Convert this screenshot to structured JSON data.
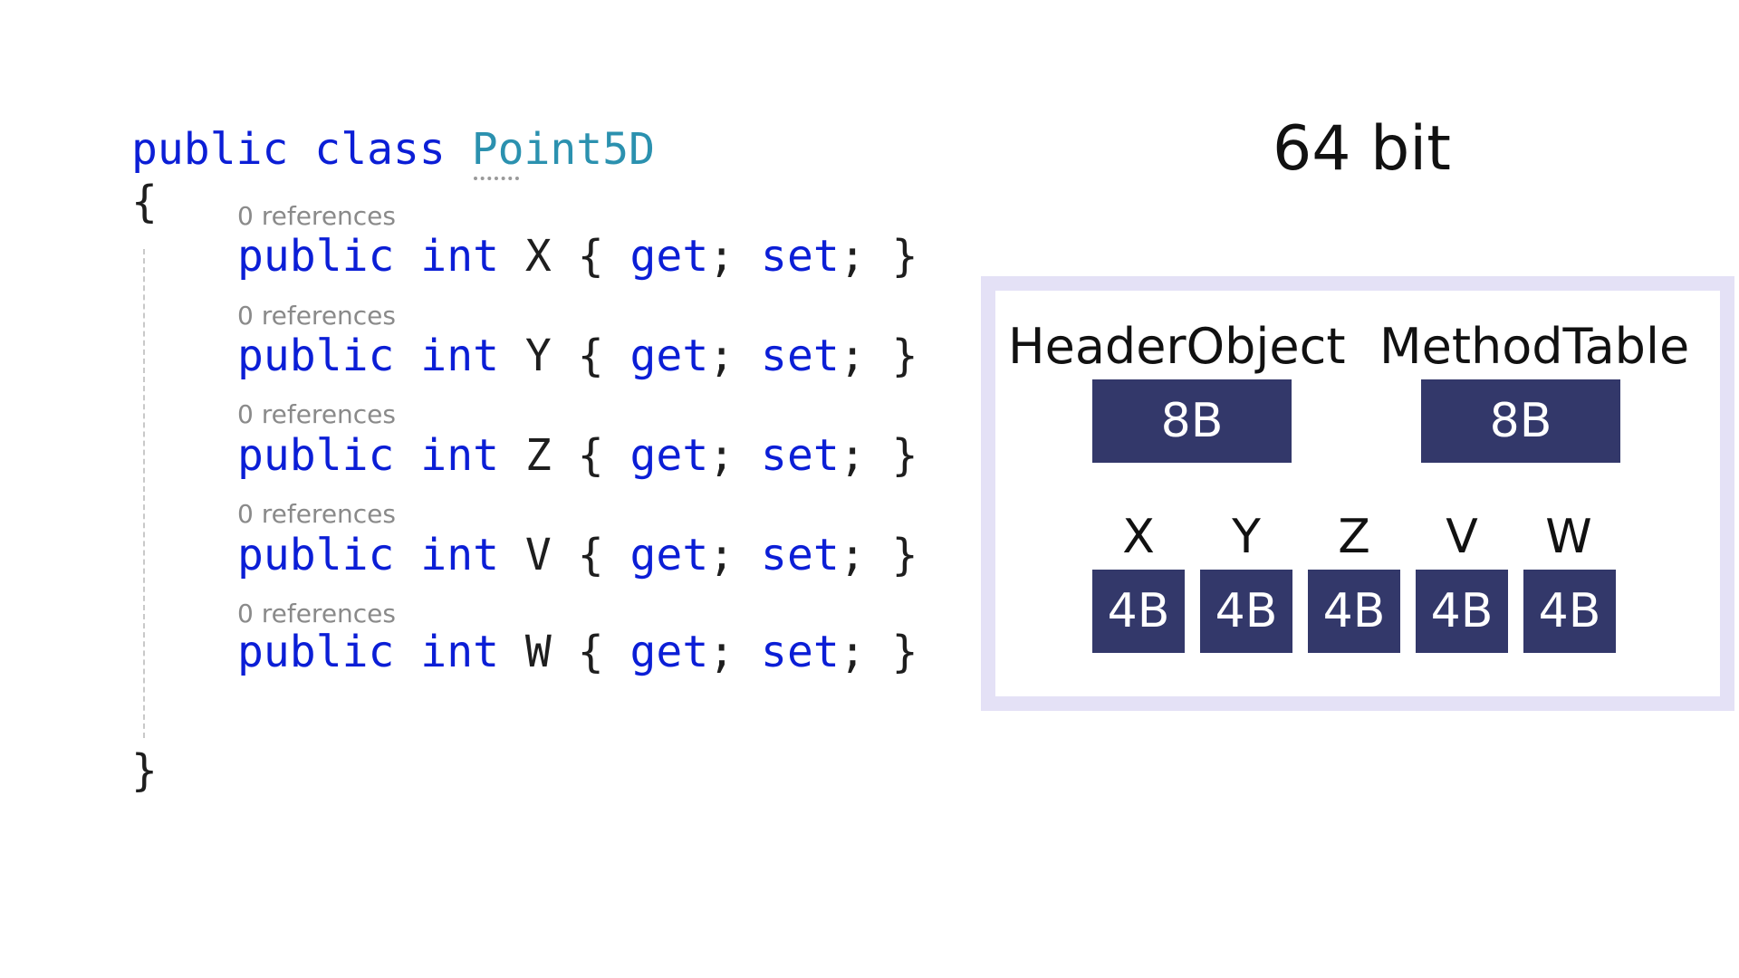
{
  "code": {
    "class_decl": {
      "kw1": "public",
      "kw2": "class",
      "type_name": "Point5D"
    },
    "open_brace": "{",
    "close_brace": "}",
    "members": [
      {
        "refs": "0 references",
        "kw1": "public",
        "kw2": "int",
        "name": "X",
        "lb": "{",
        "get": "get",
        "semi1": ";",
        "set": "set",
        "semi2": ";",
        "rb": "}"
      },
      {
        "refs": "0 references",
        "kw1": "public",
        "kw2": "int",
        "name": "Y",
        "lb": "{",
        "get": "get",
        "semi1": ";",
        "set": "set",
        "semi2": ";",
        "rb": "}"
      },
      {
        "refs": "0 references",
        "kw1": "public",
        "kw2": "int",
        "name": "Z",
        "lb": "{",
        "get": "get",
        "semi1": ";",
        "set": "set",
        "semi2": ";",
        "rb": "}"
      },
      {
        "refs": "0 references",
        "kw1": "public",
        "kw2": "int",
        "name": "V",
        "lb": "{",
        "get": "get",
        "semi1": ";",
        "set": "set",
        "semi2": ";",
        "rb": "}"
      },
      {
        "refs": "0 references",
        "kw1": "public",
        "kw2": "int",
        "name": "W",
        "lb": "{",
        "get": "get",
        "semi1": ";",
        "set": "set",
        "semi2": ";",
        "rb": "}"
      }
    ]
  },
  "diagram": {
    "title": "64 bit",
    "header_labels": [
      "HeaderObject",
      "MethodTable"
    ],
    "header_sizes": [
      "8B",
      "8B"
    ],
    "field_labels": [
      "X",
      "Y",
      "Z",
      "V",
      "W"
    ],
    "field_sizes": [
      "4B",
      "4B",
      "4B",
      "4B",
      "4B"
    ],
    "colors": {
      "block": "#33386a",
      "frame": "#e4e1f6",
      "keyword": "#0b1ed6",
      "type": "#2b91af"
    }
  }
}
